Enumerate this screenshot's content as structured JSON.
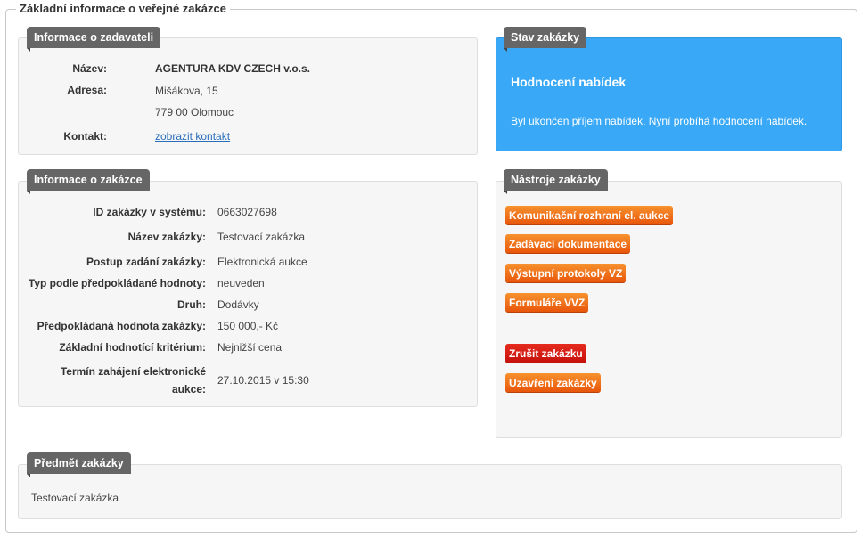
{
  "page": {
    "legend": "Základní informace o veřejné zakázce"
  },
  "zadavatel": {
    "title": "Informace o zadavateli",
    "name_label": "Název:",
    "name_value": "AGENTURA KDV CZECH v.o.s.",
    "address_label": "Adresa:",
    "address_line1": "Mišákova, 15",
    "address_line2": "779 00 Olomouc",
    "contact_label": "Kontakt:",
    "contact_link": "zobrazit kontakt"
  },
  "status": {
    "title": "Stav zakázky",
    "heading": "Hodnocení nabídek",
    "text": "Byl ukončen příjem nabídek. Nyní probíhá hodnocení nabídek."
  },
  "zakazka": {
    "title": "Informace o zakázce",
    "rows": [
      {
        "label": "ID zakázky v systému:",
        "value": "0663027698"
      },
      {
        "label": "Název zakázky:",
        "value": "Testovací zakázka"
      },
      {
        "label": "Postup zadání zakázky:",
        "value": "Elektronická  aukce"
      },
      {
        "label": "Typ podle předpokládané hodnoty:",
        "value": "neuveden"
      },
      {
        "label": "Druh:",
        "value": "Dodávky"
      },
      {
        "label": "Předpokládaná hodnota zakázky:",
        "value": "150 000,- Kč"
      },
      {
        "label": "Základní hodnotící kritérium:",
        "value": "Nejnižší cena"
      }
    ],
    "auction_label_line1": "Termín zahájení elektronické",
    "auction_label_line2": "aukce:",
    "auction_value": "27.10.2015 v 15:30"
  },
  "tools": {
    "title": "Nástroje zakázky",
    "buttons": [
      "Komunikační rozhraní el. aukce",
      "Zadávací dokumentace",
      "Výstupní protokoly VZ",
      "Formuláře VVZ",
      "Zrušit zakázku",
      "Uzavření zakázky"
    ]
  },
  "predmet": {
    "title": "Předmět zakázky",
    "text": "Testovací zakázka"
  },
  "colors": {
    "tag": "#666666",
    "status_bg": "#39a8f6",
    "button_orange": "#ef7a1e",
    "button_red": "#d91d15",
    "link": "#2a6ebb"
  }
}
